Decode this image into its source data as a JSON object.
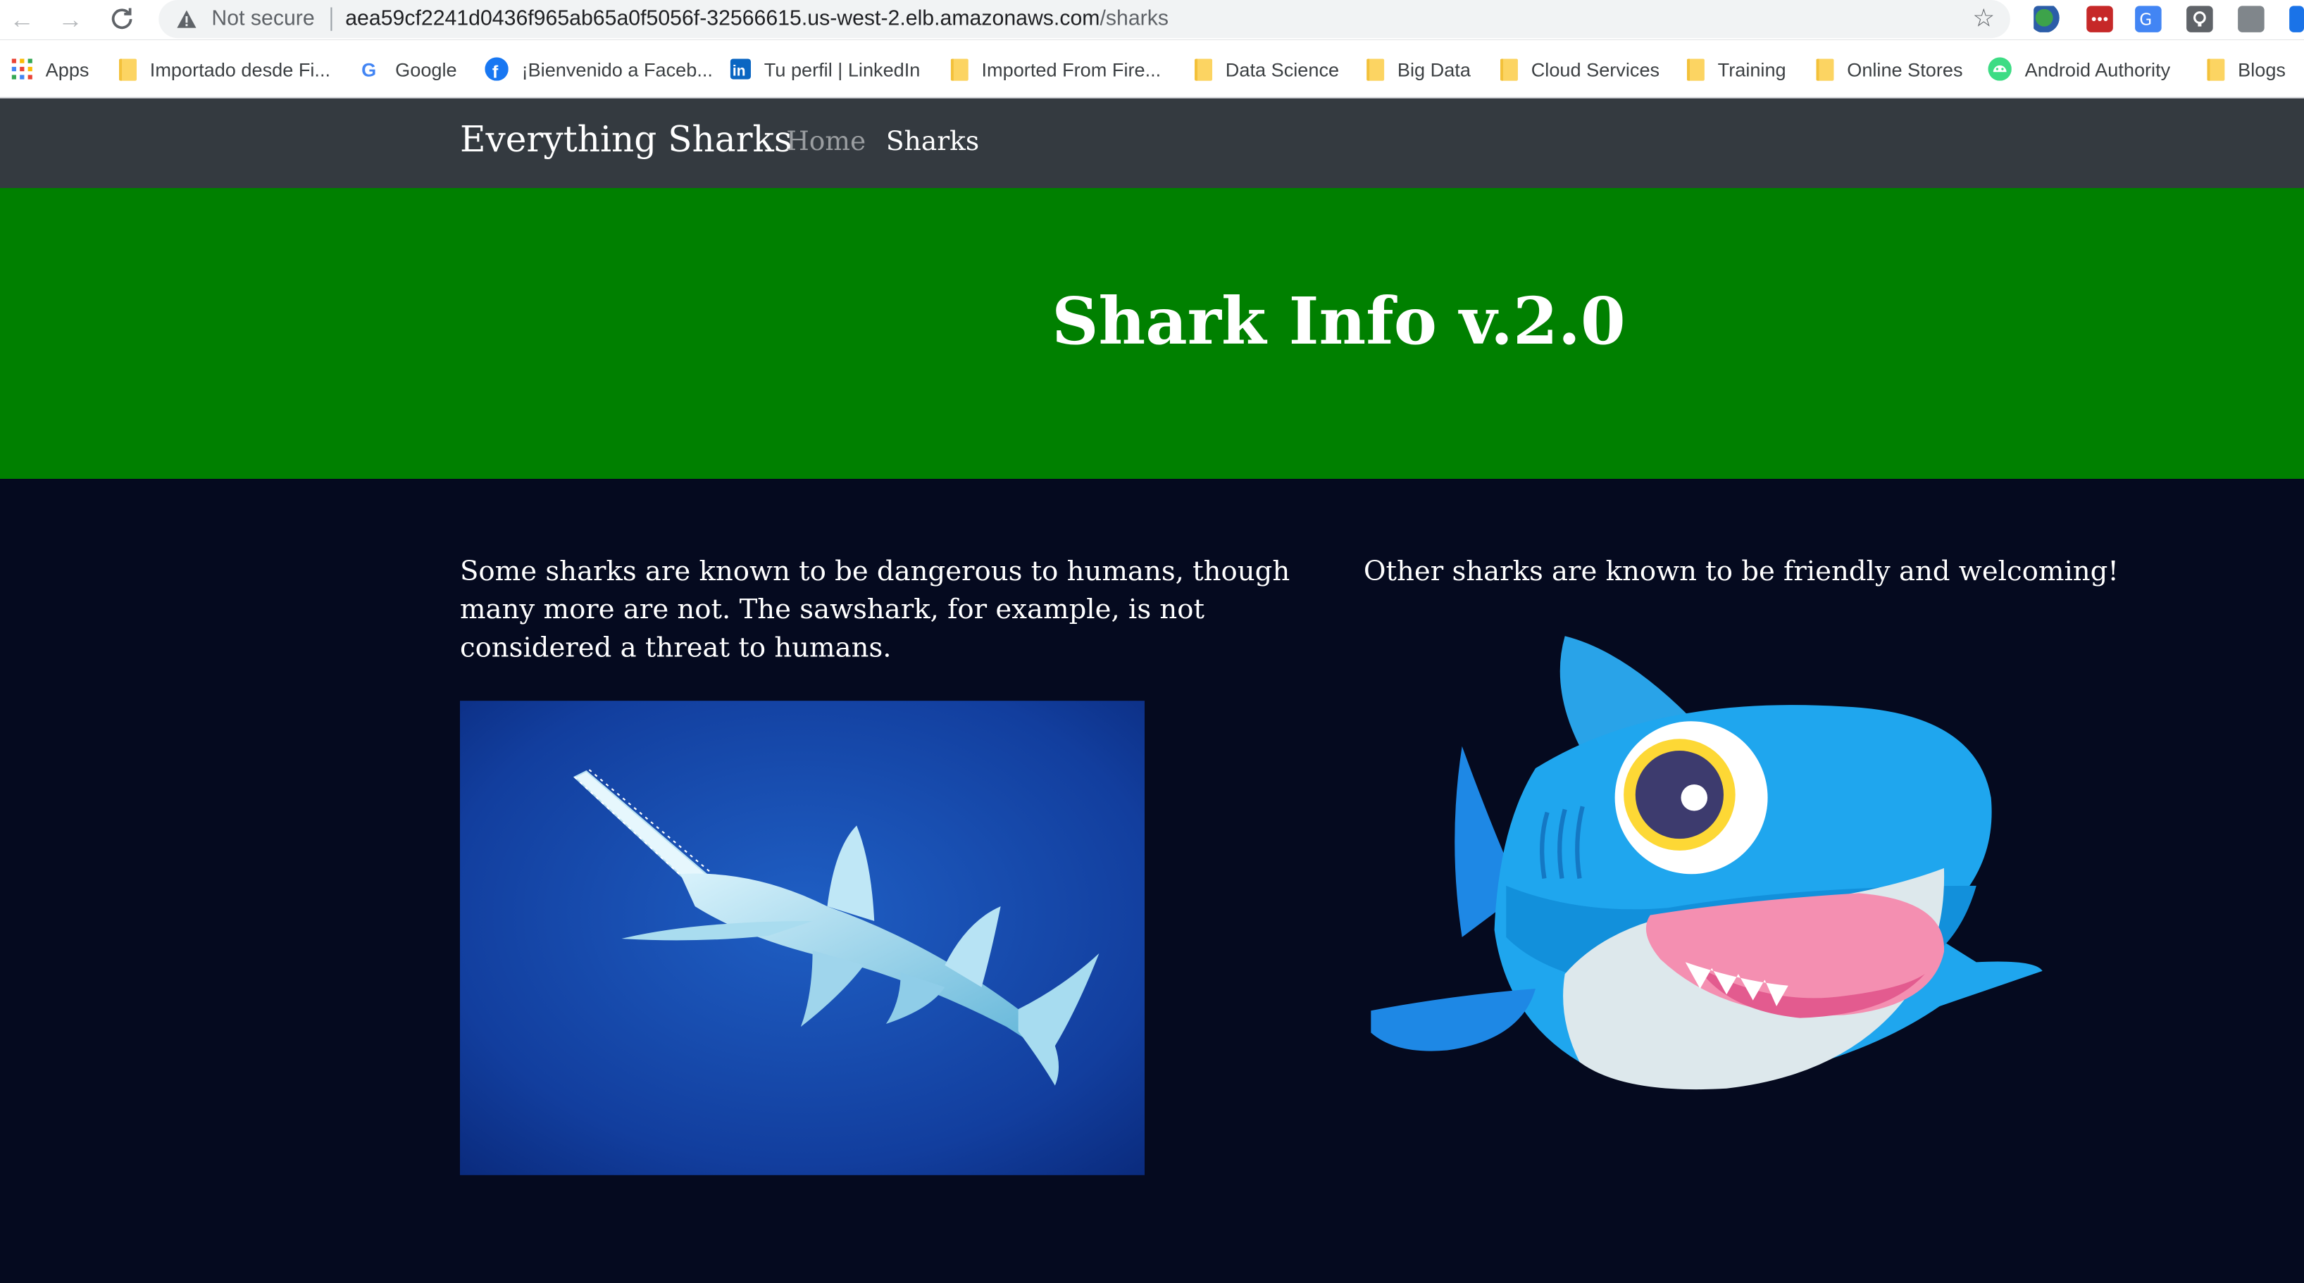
{
  "browser": {
    "security_label": "Not secure",
    "url_host": "aea59cf2241d0436f965ab65a0f5056f-32566615.us-west-2.elb.amazonaws.com",
    "url_path": "/sharks",
    "icons": [
      "back-arrow-icon",
      "forward-arrow-icon",
      "reload-icon",
      "warning-icon",
      "star-icon"
    ]
  },
  "bookmarks": [
    {
      "label": "Apps",
      "icon": "apps-grid-icon"
    },
    {
      "label": "Importado desde Fi...",
      "icon": "folder-icon"
    },
    {
      "label": "Google",
      "icon": "google-icon"
    },
    {
      "label": "¡Bienvenido a Faceb...",
      "icon": "facebook-icon"
    },
    {
      "label": "Tu perfil | LinkedIn",
      "icon": "linkedin-icon"
    },
    {
      "label": "Imported From Fire...",
      "icon": "folder-icon"
    },
    {
      "label": "Data Science",
      "icon": "folder-icon"
    },
    {
      "label": "Big Data",
      "icon": "folder-icon"
    },
    {
      "label": "Cloud Services",
      "icon": "folder-icon"
    },
    {
      "label": "Training",
      "icon": "folder-icon"
    },
    {
      "label": "Online Stores",
      "icon": "folder-icon"
    },
    {
      "label": "Android Authority",
      "icon": "android-icon"
    },
    {
      "label": "Blogs",
      "icon": "folder-icon"
    }
  ],
  "site": {
    "brand": "Everything Sharks",
    "nav": {
      "home": "Home",
      "sharks": "Sharks"
    },
    "hero_title": "Shark Info v.2.0",
    "left_text": "Some sharks are known to be dangerous to humans, though many more are not. The sawshark, for example, is not considered a threat to humans.",
    "right_text": "Other sharks are known to be friendly and welcoming!"
  },
  "colors": {
    "navbar": "#343a40",
    "hero": "#008000",
    "page_bg": "#050a1f",
    "nav_muted": "#9a9da0"
  }
}
